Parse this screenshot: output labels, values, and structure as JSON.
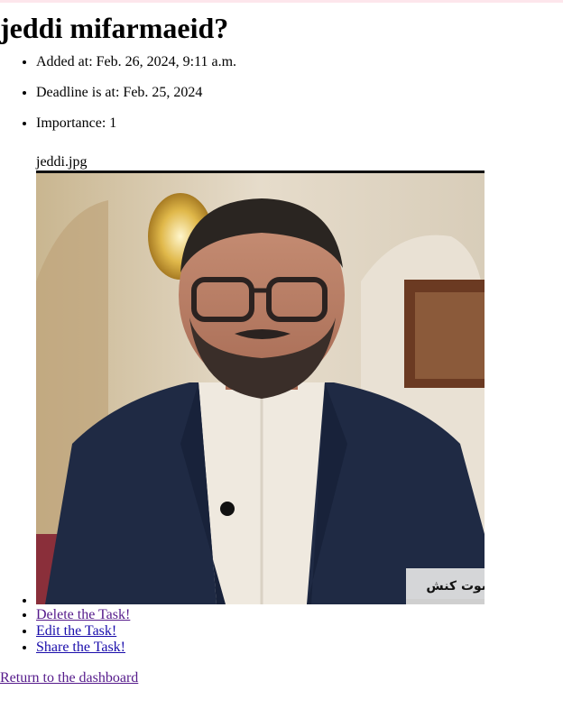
{
  "task": {
    "title": "jeddi mifarmaeid?",
    "added": "Added at: Feb. 26, 2024, 9:11 a.m.",
    "deadline": "Deadline is at: Feb. 25, 2024",
    "importance": "Importance: 1",
    "file_name": "jeddi.jpg",
    "image_overlay_text": "سوت کنش"
  },
  "actions": {
    "delete": "Delete the Task!",
    "edit": "Edit the Task!",
    "share": "Share the Task!"
  },
  "nav": {
    "return": "Return to the dashboard"
  },
  "colors": {
    "link": "#1a0dab",
    "visited_link": "#551a8b",
    "top_bar": "#fde6ec"
  }
}
